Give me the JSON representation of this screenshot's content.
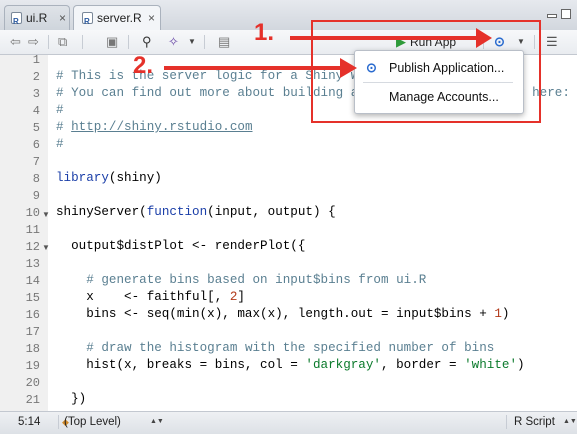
{
  "tabs": [
    {
      "label": "ui.R",
      "close": "×"
    },
    {
      "label": "server.R",
      "close": "×"
    }
  ],
  "toolbar": {
    "run_app_label": "Run App",
    "icons": [
      "back-arrow-icon",
      "forward-arrow-icon",
      "show-in-new-window-icon",
      "save-icon",
      "find-icon",
      "code-tools-wand-icon",
      "compile-report-icon",
      "publish-icon",
      "outline-icon"
    ]
  },
  "publish_menu": {
    "items": [
      {
        "label": "Publish Application..."
      },
      {
        "label": "Manage Accounts..."
      }
    ]
  },
  "annotations": {
    "step1": "1.",
    "step2": "2."
  },
  "editor": {
    "line_numbers": [
      "1",
      "2",
      "3",
      "4",
      "5",
      "6",
      "7",
      "8",
      "9",
      "10",
      "11",
      "12",
      "13",
      "14",
      "15",
      "16",
      "17",
      "18",
      "19",
      "20",
      "21"
    ]
  },
  "status": {
    "cursor": "5:14",
    "scope": "(Top Level)",
    "filetype": "R Script"
  },
  "colors": {
    "annotation_red": "#e5312a",
    "publish_blue": "#2a6bcf"
  }
}
